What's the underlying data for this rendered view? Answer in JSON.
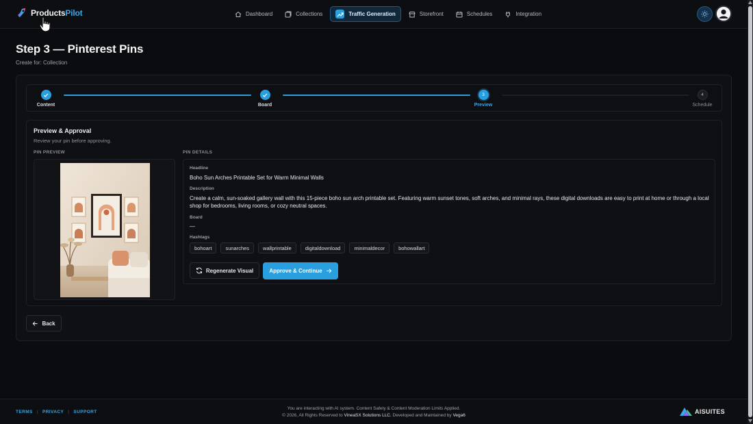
{
  "header": {
    "brand_main": "Products",
    "brand_accent": "Pilot",
    "nav": [
      {
        "label": "Dashboard",
        "icon": "home-icon"
      },
      {
        "label": "Collections",
        "icon": "collections-icon"
      },
      {
        "label": "Traffic Generation",
        "icon": "trend-icon",
        "active": true
      },
      {
        "label": "Storefront",
        "icon": "store-icon"
      },
      {
        "label": "Schedules",
        "icon": "calendar-icon"
      },
      {
        "label": "Integration",
        "icon": "plug-icon"
      }
    ]
  },
  "page": {
    "title": "Step 3 — Pinterest Pins",
    "subtitle": "Create for: Collection"
  },
  "stepper": {
    "steps": [
      {
        "label": "Content",
        "state": "done",
        "number": ""
      },
      {
        "label": "Board",
        "state": "done",
        "number": ""
      },
      {
        "label": "Preview",
        "state": "current",
        "number": "3"
      },
      {
        "label": "Schedule",
        "state": "todo",
        "number": "4"
      }
    ]
  },
  "preview": {
    "title": "Preview & Approval",
    "subtitle": "Review your pin before approving.",
    "pin_preview_caption": "PIN PREVIEW",
    "pin_details_caption": "PIN DETAILS"
  },
  "details": {
    "headline_label": "Headline",
    "headline": "Boho Sun Arches Printable Set for Warm Minimal Walls",
    "description_label": "Description",
    "description": "Create a calm, sun-soaked gallery wall with this 15-piece boho sun arch printable set. Featuring warm sunset tones, soft arches, and minimal rays, these digital downloads are easy to print at home or through a local shop for bedrooms, living rooms, or cozy neutral spaces.",
    "board_label": "Board",
    "board": "—",
    "hashtags_label": "Hashtags",
    "hashtags": [
      "bohoart",
      "sunarches",
      "wallprintable",
      "digitaldownload",
      "minimaldecor",
      "bohowallart"
    ]
  },
  "actions": {
    "regenerate": "Regenerate Visual",
    "approve": "Approve & Continue",
    "back": "Back"
  },
  "footer": {
    "links": [
      "TERMS",
      "PRIVACY",
      "SUPPORT"
    ],
    "notice": "You are interacting with AI system. Content Safety & Content Moderation Limits Applied.",
    "copyright_prefix": "© 2026, All Rights Reserved to",
    "company": "VineaSX Solutions LLC.",
    "maintained_prefix": "Developed and Maintained by",
    "maintainer": "Vega6",
    "brand": "AISUITES"
  },
  "colors": {
    "accent": "#2a9fe0",
    "background": "#0b0c0f"
  }
}
